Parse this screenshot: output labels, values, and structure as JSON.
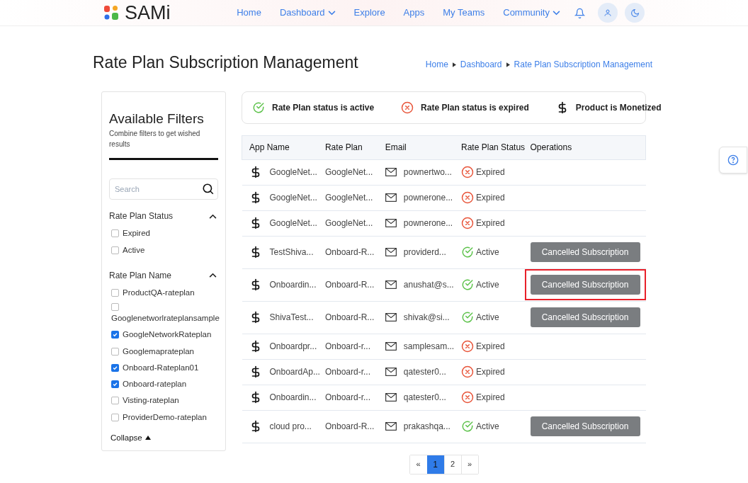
{
  "brand": {
    "name": "SAMi"
  },
  "nav": [
    {
      "label": "Home",
      "dropdown": false
    },
    {
      "label": "Dashboard",
      "dropdown": true
    },
    {
      "label": "Explore",
      "dropdown": false
    },
    {
      "label": "Apps",
      "dropdown": false
    },
    {
      "label": "My Teams",
      "dropdown": false
    },
    {
      "label": "Community",
      "dropdown": true
    }
  ],
  "page_title": "Rate Plan Subscription Management",
  "breadcrumb": [
    "Home",
    "Dashboard",
    "Rate Plan Subscription Management"
  ],
  "filters": {
    "title": "Available Filters",
    "subtitle": "Combine filters to get wished results",
    "search": {
      "placeholder": "Search"
    },
    "groups": [
      {
        "title": "Rate Plan Status",
        "expanded": true,
        "options": [
          {
            "label": "Expired",
            "checked": false
          },
          {
            "label": "Active",
            "checked": false
          }
        ]
      },
      {
        "title": "Rate Plan Name",
        "expanded": true,
        "options": [
          {
            "label": "ProductQA-rateplan",
            "checked": false
          },
          {
            "label": "Googlenetworlrateplansample",
            "checked": false
          },
          {
            "label": "GoogleNetworkRateplan",
            "checked": true
          },
          {
            "label": "Googlemaprateplan",
            "checked": false
          },
          {
            "label": "Onboard-Rateplan01",
            "checked": true
          },
          {
            "label": "Onboard-rateplan",
            "checked": true
          },
          {
            "label": "Visting-rateplan",
            "checked": false
          },
          {
            "label": "ProviderDemo-rateplan",
            "checked": false
          }
        ]
      }
    ],
    "collapse": "Collapse"
  },
  "legend": [
    {
      "kind": "active",
      "label": "Rate Plan status is active"
    },
    {
      "kind": "expired",
      "label": "Rate Plan status is expired"
    },
    {
      "kind": "monetized",
      "label": "Product is Monetized"
    }
  ],
  "table": {
    "columns": [
      "App Name",
      "Rate Plan",
      "Email",
      "Rate Plan Status",
      "Operations"
    ],
    "rows": [
      {
        "app": "GoogleNet...",
        "plan": "GoogleNet...",
        "email": "pownertwo...",
        "kind": "expired",
        "status_label": "Expired"
      },
      {
        "app": "GoogleNet...",
        "plan": "GoogleNet...",
        "email": "pownerone...",
        "kind": "expired",
        "status_label": "Expired"
      },
      {
        "app": "GoogleNet...",
        "plan": "GoogleNet...",
        "email": "pownerone...",
        "kind": "expired",
        "status_label": "Expired"
      },
      {
        "app": "TestShiva...",
        "plan": "Onboard-R...",
        "email": "providerd...",
        "kind": "active",
        "status_label": "Active",
        "operation": {
          "label": "Cancelled Subscription",
          "highlighted": false
        }
      },
      {
        "app": "Onboardin...",
        "plan": "Onboard-R...",
        "email": "anushat@s...",
        "kind": "active",
        "status_label": "Active",
        "operation": {
          "label": "Cancelled Subscription",
          "highlighted": true
        }
      },
      {
        "app": "ShivaTest...",
        "plan": "Onboard-R...",
        "email": "shivak@si...",
        "kind": "active",
        "status_label": "Active",
        "operation": {
          "label": "Cancelled Subscription",
          "highlighted": false
        }
      },
      {
        "app": "Onboardpr...",
        "plan": "Onboard-r...",
        "email": "samplesam...",
        "kind": "expired",
        "status_label": "Expired"
      },
      {
        "app": "OnboardAp...",
        "plan": "Onboard-r...",
        "email": "qatester0...",
        "kind": "expired",
        "status_label": "Expired"
      },
      {
        "app": "Onboardin...",
        "plan": "Onboard-r...",
        "email": "qatester0...",
        "kind": "expired",
        "status_label": "Expired"
      },
      {
        "app": "cloud pro...",
        "plan": "Onboard-R...",
        "email": "prakashqa...",
        "kind": "active",
        "status_label": "Active",
        "operation": {
          "label": "Cancelled Subscription",
          "highlighted": false
        }
      }
    ]
  },
  "pagination": [
    {
      "label": "«",
      "selected": false
    },
    {
      "label": "1",
      "selected": true
    },
    {
      "label": "2",
      "selected": false
    },
    {
      "label": "»",
      "selected": false
    }
  ]
}
